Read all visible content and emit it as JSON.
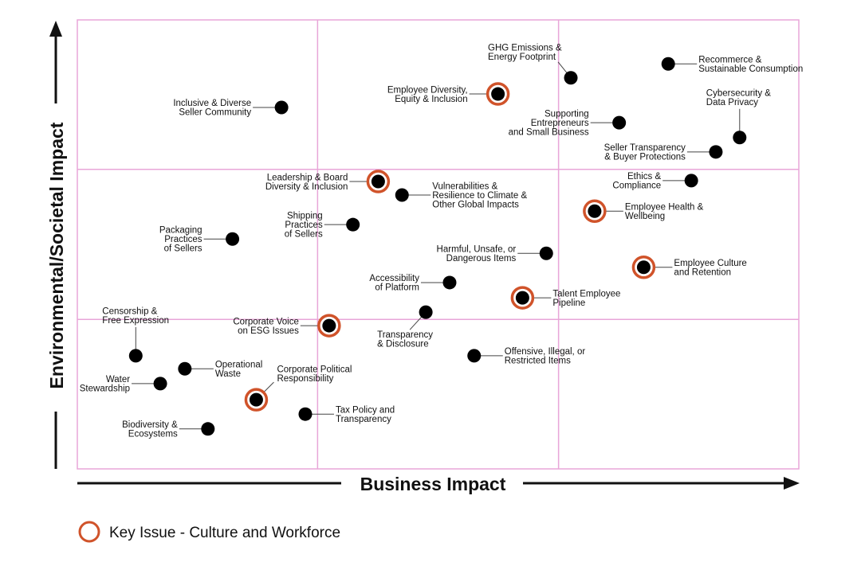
{
  "chart_data": {
    "type": "scatter",
    "title": "",
    "xlabel": "Business Impact",
    "ylabel": "Environmental/Societal Impact",
    "xlim": [
      0,
      100
    ],
    "ylim": [
      0,
      100
    ],
    "grid": {
      "x_dividers": [
        33.3,
        66.7
      ],
      "y_dividers": [
        33.3,
        66.7
      ]
    },
    "colors": {
      "grid": "#e8a6d8",
      "point": "#000000",
      "key_ring": "#d0532a",
      "axis": "#111111"
    },
    "legend": {
      "position": "bottom-left",
      "entries": [
        {
          "label": "Key Issue - Culture and Workforce",
          "marker": "ring"
        }
      ]
    },
    "points": [
      {
        "name": "Inclusive & Diverse Seller Community",
        "lines": [
          "Inclusive & Diverse",
          "Seller Community"
        ],
        "x": 28.3,
        "y": 80.5,
        "key": false,
        "label_side": "left"
      },
      {
        "name": "Employee Diversity, Equity & Inclusion",
        "lines": [
          "Employee Diversity,",
          "Equity & Inclusion"
        ],
        "x": 58.3,
        "y": 83.5,
        "key": true,
        "label_side": "left"
      },
      {
        "name": "GHG Emissions & Energy Footprint",
        "lines": [
          "GHG Emissions &",
          "Energy Footprint"
        ],
        "x": 68.4,
        "y": 87.1,
        "key": false,
        "label_side": "top-left"
      },
      {
        "name": "Recommerce & Sustainable Consumption",
        "lines": [
          "Recommerce &",
          "Sustainable Consumption"
        ],
        "x": 81.9,
        "y": 90.2,
        "key": false,
        "label_side": "right"
      },
      {
        "name": "Supporting Entrepreneurs and Small Business",
        "lines": [
          "Supporting",
          "Entrepreneurs",
          "and Small Business"
        ],
        "x": 75.1,
        "y": 77.1,
        "key": false,
        "label_side": "left"
      },
      {
        "name": "Cybersecurity & Data Privacy",
        "lines": [
          "Cybersecurity &",
          "Data Privacy"
        ],
        "x": 91.8,
        "y": 73.8,
        "key": false,
        "label_side": "top"
      },
      {
        "name": "Seller Transparency & Buyer Protections",
        "lines": [
          "Seller Transparency",
          "& Buyer Protections"
        ],
        "x": 88.5,
        "y": 70.6,
        "key": false,
        "label_side": "left"
      },
      {
        "name": "Leadership & Board Diversity & Inclusion",
        "lines": [
          "Leadership & Board",
          "Diversity & Inclusion"
        ],
        "x": 41.7,
        "y": 64.0,
        "key": true,
        "label_side": "left"
      },
      {
        "name": "Vulnerabilities & Resilience to Climate & Other Global Impacts",
        "lines": [
          "Vulnerabilities &",
          "Resilience to Climate &",
          "Other Global Impacts"
        ],
        "x": 45.0,
        "y": 61.0,
        "key": false,
        "label_side": "right"
      },
      {
        "name": "Ethics & Compliance",
        "lines": [
          "Ethics &",
          "Compliance"
        ],
        "x": 85.1,
        "y": 64.2,
        "key": false,
        "label_side": "left"
      },
      {
        "name": "Employee Health & Wellbeing",
        "lines": [
          "Employee Health &",
          "Wellbeing"
        ],
        "x": 71.7,
        "y": 57.4,
        "key": true,
        "label_side": "right"
      },
      {
        "name": "Shipping Practices of Sellers",
        "lines": [
          "Shipping",
          "Practices",
          "of Sellers"
        ],
        "x": 38.2,
        "y": 54.4,
        "key": false,
        "label_side": "left"
      },
      {
        "name": "Packaging Practices of Sellers",
        "lines": [
          "Packaging",
          "Practices",
          "of Sellers"
        ],
        "x": 21.5,
        "y": 51.2,
        "key": false,
        "label_side": "left"
      },
      {
        "name": "Harmful, Unsafe, or Dangerous Items",
        "lines": [
          "Harmful, Unsafe, or",
          "Dangerous Items"
        ],
        "x": 65.0,
        "y": 48.0,
        "key": false,
        "label_side": "left"
      },
      {
        "name": "Employee Culture and Retention",
        "lines": [
          "Employee Culture",
          "and Retention"
        ],
        "x": 78.5,
        "y": 44.9,
        "key": true,
        "label_side": "right"
      },
      {
        "name": "Accessibility of Platform",
        "lines": [
          "Accessibility",
          "of Platform"
        ],
        "x": 51.6,
        "y": 41.5,
        "key": false,
        "label_side": "left"
      },
      {
        "name": "Talent Employee Pipeline",
        "lines": [
          "Talent Employee",
          "Pipeline"
        ],
        "x": 61.7,
        "y": 38.1,
        "key": true,
        "label_side": "right"
      },
      {
        "name": "Transparency & Disclosure",
        "lines": [
          "Transparency",
          "& Disclosure"
        ],
        "x": 48.3,
        "y": 34.9,
        "key": false,
        "label_side": "bottom-left"
      },
      {
        "name": "Corporate Voice on ESG Issues",
        "lines": [
          "Corporate Voice",
          "on ESG Issues"
        ],
        "x": 34.9,
        "y": 31.9,
        "key": true,
        "label_side": "left"
      },
      {
        "name": "Censorship & Free Expression",
        "lines": [
          "Censorship &",
          "Free Expression"
        ],
        "x": 8.1,
        "y": 25.2,
        "key": false,
        "label_side": "top"
      },
      {
        "name": "Offensive, Illegal, or Restricted Items",
        "lines": [
          "Offensive, Illegal, or",
          "Restricted Items"
        ],
        "x": 55.0,
        "y": 25.2,
        "key": false,
        "label_side": "right"
      },
      {
        "name": "Operational Waste",
        "lines": [
          "Operational",
          "Waste"
        ],
        "x": 14.9,
        "y": 22.3,
        "key": false,
        "label_side": "right"
      },
      {
        "name": "Water Stewardship",
        "lines": [
          "Water",
          "Stewardship"
        ],
        "x": 11.5,
        "y": 19.0,
        "key": false,
        "label_side": "left"
      },
      {
        "name": "Corporate Political Responsibility",
        "lines": [
          "Corporate Political",
          "Responsibility"
        ],
        "x": 24.8,
        "y": 15.4,
        "key": true,
        "label_side": "top-right"
      },
      {
        "name": "Tax Policy and Transparency",
        "lines": [
          "Tax Policy and",
          "Transparency"
        ],
        "x": 31.6,
        "y": 12.2,
        "key": false,
        "label_side": "right"
      },
      {
        "name": "Biodiversity & Ecosystems",
        "lines": [
          "Biodiversity &",
          "Ecosystems"
        ],
        "x": 18.1,
        "y": 8.9,
        "key": false,
        "label_side": "left"
      }
    ]
  }
}
